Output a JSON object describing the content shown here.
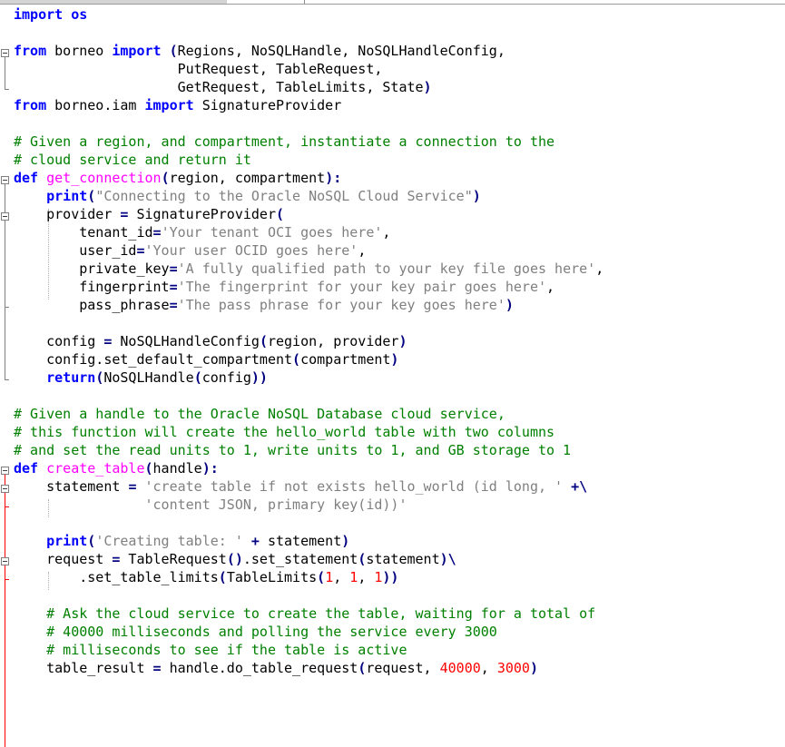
{
  "code_lines": [
    "import os",
    "",
    "from borneo import (Regions, NoSQLHandle, NoSQLHandleConfig,",
    "                    PutRequest, TableRequest,",
    "                    GetRequest, TableLimits, State)",
    "from borneo.iam import SignatureProvider",
    "",
    "# Given a region, and compartment, instantiate a connection to the",
    "# cloud service and return it",
    "def get_connection(region, compartment):",
    "    print(\"Connecting to the Oracle NoSQL Cloud Service\")",
    "    provider = SignatureProvider(",
    "        tenant_id='Your tenant OCI goes here',",
    "        user_id='Your user OCID goes here',",
    "        private_key='A fully qualified path to your key file goes here',",
    "        fingerprint='The fingerprint for your key pair goes here',",
    "        pass_phrase='The pass phrase for your key goes here')",
    "",
    "    config = NoSQLHandleConfig(region, provider)",
    "    config.set_default_compartment(compartment)",
    "    return(NoSQLHandle(config))",
    "",
    "# Given a handle to the Oracle NoSQL Database cloud service,",
    "# this function will create the hello_world table with two columns",
    "# and set the read units to 1, write units to 1, and GB storage to 1",
    "def create_table(handle):",
    "    statement = 'create table if not exists hello_world (id long, ' +\\",
    "                'content JSON, primary key(id))'",
    "",
    "    print('Creating table: ' + statement)",
    "    request = TableRequest().set_statement(statement)\\",
    "        .set_table_limits(TableLimits(1, 1, 1))",
    "",
    "    # Ask the cloud service to create the table, waiting for a total of",
    "    # 40000 milliseconds and polling the service every 3000",
    "    # milliseconds to see if the table is active",
    "    table_result = handle.do_table_request(request, 40000, 3000)"
  ]
}
